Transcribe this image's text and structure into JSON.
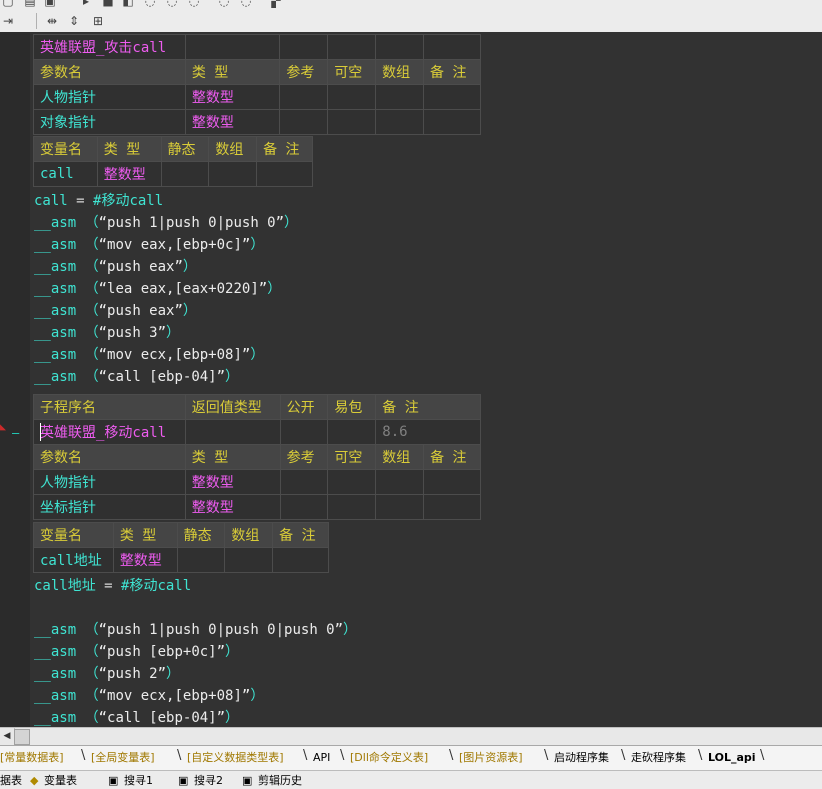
{
  "editor": {
    "table1": {
      "title_row": [
        "英雄联盟_攻击call",
        "",
        "",
        "",
        "",
        ""
      ],
      "header": [
        "参数名",
        "类 型",
        "参考",
        "可空",
        "数组",
        "备 注"
      ],
      "rows": [
        [
          "人物指针",
          "整数型",
          "",
          "",
          "",
          ""
        ],
        [
          "对象指针",
          "整数型",
          "",
          "",
          "",
          ""
        ]
      ]
    },
    "table2": {
      "header": [
        "变量名",
        "类 型",
        "静态",
        "数组",
        "备 注"
      ],
      "rows": [
        [
          "call",
          "整数型",
          "",
          "",
          ""
        ]
      ]
    },
    "code1": [
      {
        "kw": "call",
        "op": " = ",
        "str": "#移动call"
      },
      {
        "kw": "__asm",
        "arg": "push 1|push 0|push 0"
      },
      {
        "kw": "__asm",
        "arg": "mov eax,[ebp+0c]"
      },
      {
        "kw": "__asm",
        "arg": "push eax"
      },
      {
        "kw": "__asm",
        "arg": "lea eax,[eax+0220]"
      },
      {
        "kw": "__asm",
        "arg": "push eax"
      },
      {
        "kw": "__asm",
        "arg": "push 3"
      },
      {
        "kw": "__asm",
        "arg": "mov ecx,[ebp+08]"
      },
      {
        "kw": "__asm",
        "arg": "call [ebp-04]"
      }
    ],
    "table3": {
      "header": [
        "子程序名",
        "返回值类型",
        "公开",
        "易包",
        "备 注"
      ],
      "name_row": [
        "英雄联盟_移动call",
        "",
        "",
        "",
        "8.6"
      ],
      "param_header": [
        "参数名",
        "类 型",
        "参考",
        "可空",
        "数组",
        "备 注"
      ],
      "rows": [
        [
          "人物指针",
          "整数型",
          "",
          "",
          "",
          ""
        ],
        [
          "坐标指针",
          "整数型",
          "",
          "",
          "",
          ""
        ]
      ]
    },
    "table4": {
      "header": [
        "变量名",
        "类 型",
        "静态",
        "数组",
        "备 注"
      ],
      "rows": [
        [
          "call地址",
          "整数型",
          "",
          "",
          ""
        ]
      ]
    },
    "code2": [
      {
        "kw": "call地址",
        "op": " = ",
        "str": "#移动call"
      },
      {
        "kw": "",
        "arg": null
      },
      {
        "kw": "__asm",
        "arg": "push 1|push 0|push 0|push 0"
      },
      {
        "kw": "__asm",
        "arg": "push [ebp+0c]"
      },
      {
        "kw": "__asm",
        "arg": "push 2"
      },
      {
        "kw": "__asm",
        "arg": "mov ecx,[ebp+08]"
      },
      {
        "kw": "__asm",
        "arg": "call [ebp-04]"
      }
    ]
  },
  "tabs": [
    {
      "label": "[常量数据表]",
      "style": "y"
    },
    {
      "label": "[全局变量表]",
      "style": "y"
    },
    {
      "label": "[自定义数据类型表]",
      "style": "y"
    },
    {
      "label": "API",
      "style": "b"
    },
    {
      "label": "[Dll命令定义表]",
      "style": "y"
    },
    {
      "label": "[图片资源表]",
      "style": "y"
    },
    {
      "label": "启动程序集",
      "style": "b"
    },
    {
      "label": "走砍程序集",
      "style": "b"
    },
    {
      "label": "LOL_api",
      "style": "bold"
    }
  ],
  "bottom_bar": {
    "items": [
      "据表",
      "变量表",
      "搜寻1",
      "搜寻2",
      "剪辑历史"
    ]
  },
  "colors": {
    "editor_bg": "#323232",
    "header_bg": "#454545",
    "header_text": "#d9cc38",
    "name_text": "#3fe4d2",
    "type_text": "#ee5cf0"
  }
}
